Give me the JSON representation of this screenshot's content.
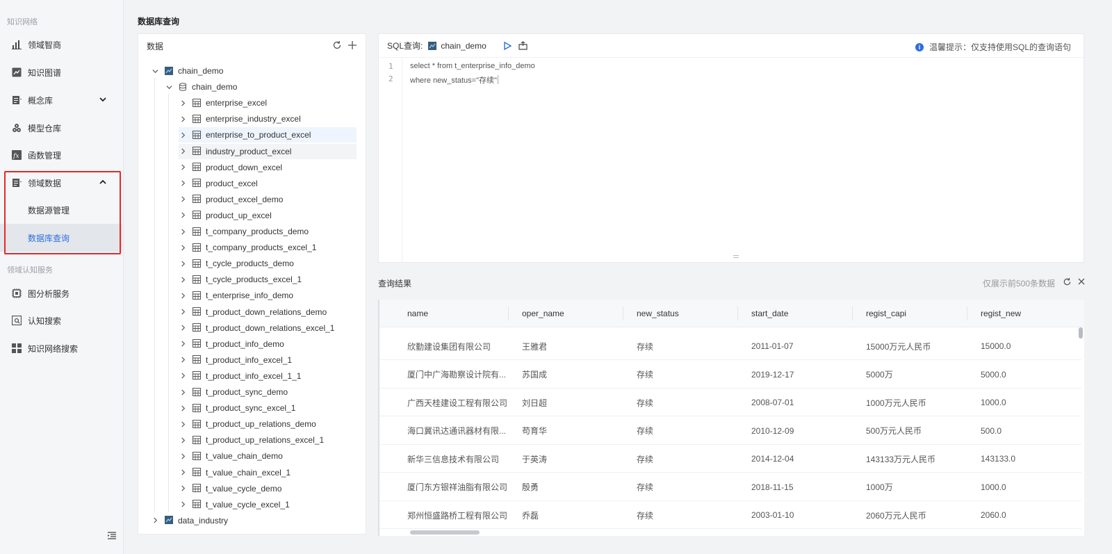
{
  "sidebar": {
    "section1": "知识网络",
    "items": [
      {
        "label": "领域智商",
        "icon": "bar-chart-icon"
      },
      {
        "label": "知识图谱",
        "icon": "graph-image-icon"
      },
      {
        "label": "概念库",
        "icon": "document-list-icon"
      },
      {
        "label": "模型仓库",
        "icon": "cubes-icon"
      },
      {
        "label": "函数管理",
        "icon": "function-icon"
      },
      {
        "label": "领域数据",
        "icon": "document-list-icon"
      }
    ],
    "subitems": [
      {
        "label": "数据源管理"
      },
      {
        "label": "数据库查询",
        "active": true
      }
    ],
    "section2": "领域认知服务",
    "items2": [
      {
        "label": "图分析服务",
        "icon": "chip-icon"
      },
      {
        "label": "认知搜索",
        "icon": "search-box-icon"
      },
      {
        "label": "知识网络搜索",
        "icon": "grid-icon"
      }
    ]
  },
  "page": {
    "title": "数据库查询"
  },
  "data_panel": {
    "title": "数据",
    "tree": {
      "root": "chain_demo",
      "schema": "chain_demo",
      "tables": [
        "enterprise_excel",
        "enterprise_industry_excel",
        "enterprise_to_product_excel",
        "industry_product_excel",
        "product_down_excel",
        "product_excel",
        "product_excel_demo",
        "product_up_excel",
        "t_company_products_demo",
        "t_company_products_excel_1",
        "t_cycle_products_demo",
        "t_cycle_products_excel_1",
        "t_enterprise_info_demo",
        "t_product_down_relations_demo",
        "t_product_down_relations_excel_1",
        "t_product_info_demo",
        "t_product_info_excel_1",
        "t_product_info_excel_1_1",
        "t_product_sync_demo",
        "t_product_sync_excel_1",
        "t_product_up_relations_demo",
        "t_product_up_relations_excel_1",
        "t_value_chain_demo",
        "t_value_chain_excel_1",
        "t_value_cycle_demo",
        "t_value_cycle_excel_1"
      ],
      "other_root": "data_industry"
    }
  },
  "sql_panel": {
    "label": "SQL查询:",
    "db": "chain_demo",
    "tip": "温馨提示：仅支持使用SQL的查询语句",
    "lines": [
      {
        "num": "1",
        "text": "select * from t_enterprise_info_demo"
      },
      {
        "num": "2",
        "text": "where new_status=\"存续\""
      }
    ]
  },
  "results": {
    "title": "查询结果",
    "note": "仅展示前500条数据",
    "columns": [
      "name",
      "oper_name",
      "new_status",
      "start_date",
      "regist_capi",
      "regist_new"
    ],
    "rows": [
      [
        "欣勤建设集团有限公司",
        "王雅君",
        "存续",
        "2011-01-07",
        "15000万元人民币",
        "15000.0"
      ],
      [
        "厦门中广海勘察设计院有...",
        "苏国成",
        "存续",
        "2019-12-17",
        "5000万",
        "5000.0"
      ],
      [
        "广西天桂建设工程有限公司",
        "刘日超",
        "存续",
        "2008-07-01",
        "1000万元人民币",
        "1000.0"
      ],
      [
        "海口冀讯达通讯器材有限...",
        "苟育华",
        "存续",
        "2010-12-09",
        "500万元人民币",
        "500.0"
      ],
      [
        "新华三信息技术有限公司",
        "于英涛",
        "存续",
        "2014-12-04",
        "143133万元人民币",
        "143133.0"
      ],
      [
        "厦门东方银祥油脂有限公司",
        "殷勇",
        "存续",
        "2018-11-15",
        "1000万",
        "1000.0"
      ],
      [
        "郑州恒盛路桥工程有限公司",
        "乔磊",
        "存续",
        "2003-01-10",
        "2060万元人民币",
        "2060.0"
      ]
    ]
  },
  "colors": {
    "accent": "#2f6fde",
    "highlight_box": "#e8262a",
    "sidebar_bg": "#f5f6f7"
  }
}
